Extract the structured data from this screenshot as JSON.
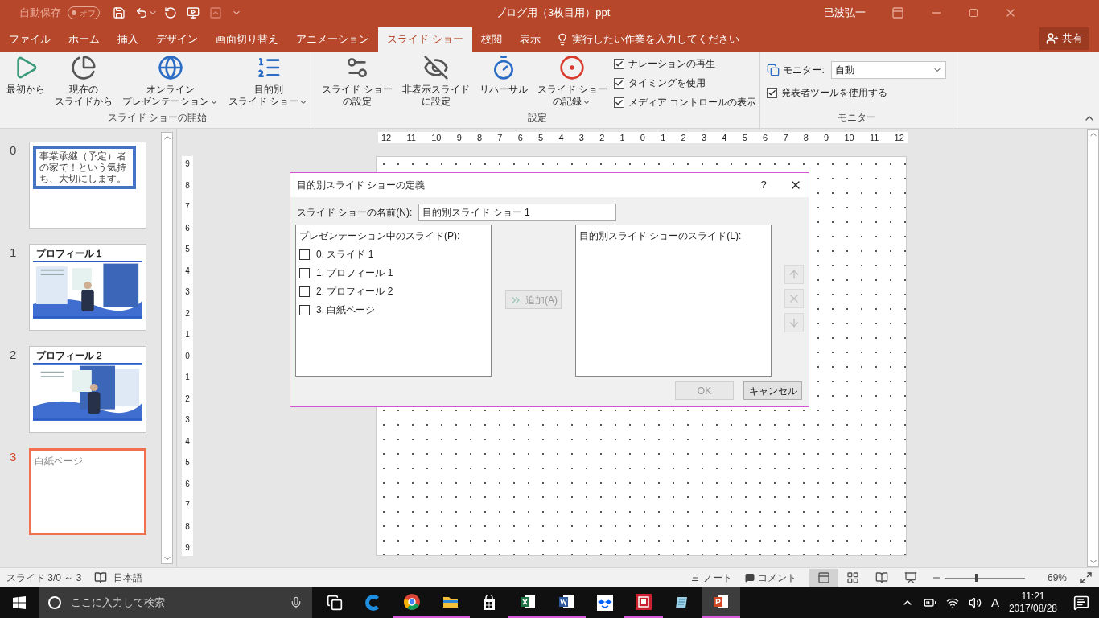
{
  "title_bar": {
    "autosave_label": "自動保存",
    "autosave_toggle": {
      "label": "オフ",
      "on": false
    },
    "title": "ブログ用（3枚目用）ppt",
    "user": "巳波弘一"
  },
  "ribbon_tabs": [
    {
      "label": "ファイル",
      "selected": false
    },
    {
      "label": "ホーム",
      "selected": false
    },
    {
      "label": "挿入",
      "selected": false
    },
    {
      "label": "デザイン",
      "selected": false
    },
    {
      "label": "画面切り替え",
      "selected": false
    },
    {
      "label": "アニメーション",
      "selected": false
    },
    {
      "label": "スライド ショー",
      "selected": true
    },
    {
      "label": "校閲",
      "selected": false
    },
    {
      "label": "表示",
      "selected": false
    }
  ],
  "tell_me": "実行したい作業を入力してください",
  "share": "共有",
  "ribbon_groups": [
    {
      "label": "スライド ショーの開始",
      "buttons": [
        {
          "kind": "play",
          "lines": [
            "最初から"
          ],
          "dropdown": false
        },
        {
          "kind": "current",
          "lines": [
            "現在の",
            "スライドから"
          ],
          "dropdown": false
        },
        {
          "kind": "online",
          "lines": [
            "オンライン",
            "プレゼンテーション"
          ],
          "dropdown": true
        },
        {
          "kind": "custom",
          "lines": [
            "目的別",
            "スライド ショー"
          ],
          "dropdown": true
        }
      ]
    },
    {
      "label": "設定",
      "buttons": [
        {
          "kind": "setup",
          "lines": [
            "スライド ショー",
            "の設定"
          ],
          "dropdown": false
        },
        {
          "kind": "hide",
          "lines": [
            "非表示スライド",
            "に設定"
          ],
          "dropdown": false
        },
        {
          "kind": "rehearse",
          "lines": [
            "リハーサル"
          ],
          "dropdown": false
        },
        {
          "kind": "record",
          "lines": [
            "スライド ショー",
            "の記録"
          ],
          "dropdown": true
        }
      ],
      "checkboxes": [
        {
          "label": "ナレーションの再生",
          "checked": true
        },
        {
          "label": "タイミングを使用",
          "checked": true
        },
        {
          "label": "メディア コントロールの表示",
          "checked": true
        }
      ]
    }
  ],
  "monitor_group": {
    "label": "モニター",
    "monitor_label": "モニター:",
    "monitor_value": "自動",
    "presenter_view": {
      "label": "発表者ツールを使用する",
      "checked": true
    }
  },
  "slides": [
    {
      "number": "0",
      "selected": false,
      "kind": "text_box",
      "text": "事業承継（予定）者の家で！という気持ち、大切にします。"
    },
    {
      "number": "1",
      "selected": false,
      "kind": "photo_layout",
      "title": "プロフィール１"
    },
    {
      "number": "2",
      "selected": false,
      "kind": "photo_layout",
      "title": "プロフィール２"
    },
    {
      "number": "3",
      "selected": true,
      "kind": "blank",
      "title": "白紙ページ"
    }
  ],
  "horizontal_ruler": [
    "12",
    "11",
    "10",
    "9",
    "8",
    "7",
    "6",
    "5",
    "4",
    "3",
    "2",
    "1",
    "0",
    "1",
    "2",
    "3",
    "4",
    "5",
    "6",
    "7",
    "8",
    "9",
    "10",
    "11",
    "12"
  ],
  "vertical_ruler": [
    "9",
    "8",
    "7",
    "6",
    "5",
    "4",
    "3",
    "2",
    "1",
    "0",
    "1",
    "2",
    "3",
    "4",
    "5",
    "6",
    "7",
    "8",
    "9"
  ],
  "dialog": {
    "title": "目的別スライド ショーの定義",
    "help": "?",
    "name_label": "スライド ショーの名前(N):",
    "name_value": "目的別スライド ショー 1",
    "left_list": {
      "header": "プレゼンテーション中のスライド(P):",
      "items": [
        {
          "label": "0. スライド 1",
          "checked": false
        },
        {
          "label": "1. プロフィール 1",
          "checked": false
        },
        {
          "label": "2. プロフィール 2",
          "checked": false
        },
        {
          "label": "3. 白紙ページ",
          "checked": false
        }
      ]
    },
    "add_button": {
      "label": "追加(A)",
      "disabled": true
    },
    "right_list": {
      "header": "目的別スライド ショーのスライド(L):"
    },
    "side_buttons": [
      {
        "kind": "up",
        "disabled": true
      },
      {
        "kind": "remove",
        "disabled": true
      },
      {
        "kind": "down",
        "disabled": true
      }
    ],
    "ok_button": {
      "label": "OK",
      "disabled": true
    },
    "cancel_button": {
      "label": "キャンセル",
      "disabled": false
    }
  },
  "status_bar": {
    "slide_info": "スライド 3/0 ～ 3",
    "language": "日本語",
    "notes": "ノート",
    "comments": "コメント",
    "views": [
      {
        "kind": "normal",
        "selected": true
      },
      {
        "kind": "sorter",
        "selected": false
      },
      {
        "kind": "reading",
        "selected": false
      },
      {
        "kind": "slideshow",
        "selected": false
      }
    ],
    "zoom": {
      "level": 0.38,
      "reading": "69%"
    }
  },
  "taskbar": {
    "search_placeholder": "ここに入力して検索",
    "apps": [
      {
        "kind": "taskview",
        "running": false,
        "selected": false
      },
      {
        "kind": "edge",
        "running": false,
        "selected": false
      },
      {
        "kind": "chrome",
        "running": true,
        "selected": false
      },
      {
        "kind": "explorer",
        "running": true,
        "selected": false
      },
      {
        "kind": "store",
        "running": false,
        "selected": false
      },
      {
        "kind": "excel",
        "running": true,
        "selected": false
      },
      {
        "kind": "word",
        "running": true,
        "selected": false
      },
      {
        "kind": "dropbox",
        "running": false,
        "selected": false
      },
      {
        "kind": "redapp",
        "running": true,
        "selected": false
      },
      {
        "kind": "notes",
        "running": false,
        "selected": false
      },
      {
        "kind": "powerpoint",
        "running": true,
        "selected": true
      }
    ],
    "ime": "A",
    "time": "11:21",
    "date": "2017/08/28"
  }
}
